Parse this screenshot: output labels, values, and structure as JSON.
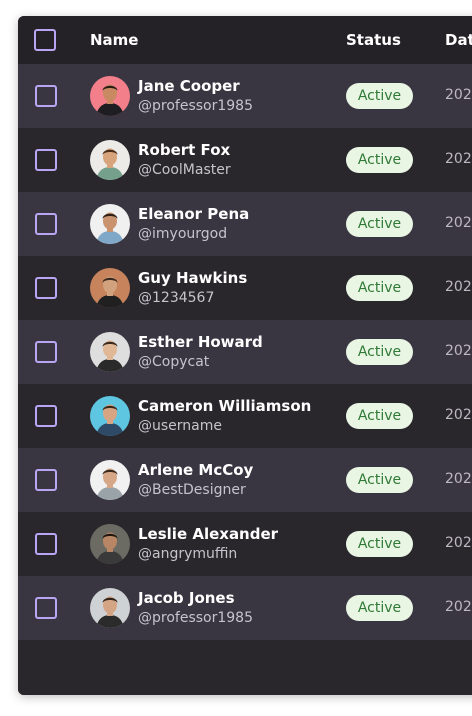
{
  "header": {
    "name_label": "Name",
    "status_label": "Status",
    "date_label": "Dat"
  },
  "colors": {
    "card_bg": "#2a282e",
    "row_alt": "#3a3641",
    "checkbox_border": "#b9a6f2",
    "badge_bg": "#e9f6e4",
    "badge_text": "#2f7a36"
  },
  "users": [
    {
      "name": "Jane Cooper",
      "handle": "@professor1985",
      "status": "Active",
      "date": "202",
      "avatar_bg": "#f27f8a",
      "skin": "#c98a63",
      "hair": "#2b1d16",
      "shirt": "#1d1d22"
    },
    {
      "name": "Robert Fox",
      "handle": "@CoolMaster",
      "status": "Active",
      "date": "202",
      "avatar_bg": "#ecebe8",
      "skin": "#d7a47c",
      "hair": "#4a2f1d",
      "shirt": "#74a08c"
    },
    {
      "name": "Eleanor Pena",
      "handle": "@imyourgod",
      "status": "Active",
      "date": "202",
      "avatar_bg": "#f0f0f0",
      "skin": "#c8936e",
      "hair": "#2c2019",
      "shirt": "#7fa8c8"
    },
    {
      "name": "Guy Hawkins",
      "handle": "@1234567",
      "status": "Active",
      "date": "202",
      "avatar_bg": "#c7835c",
      "skin": "#d2a17e",
      "hair": "#3a2a20",
      "shirt": "#202020"
    },
    {
      "name": "Esther Howard",
      "handle": "@Copycat",
      "status": "Active",
      "date": "202",
      "avatar_bg": "#dedede",
      "skin": "#e0b896",
      "hair": "#3b2a1f",
      "shirt": "#2a2a2a"
    },
    {
      "name": "Cameron Williamson",
      "handle": "@username",
      "status": "Active",
      "date": "202",
      "avatar_bg": "#5ec6e0",
      "skin": "#d8a584",
      "hair": "#3a2a1e",
      "shirt": "#2f4a66"
    },
    {
      "name": "Arlene McCoy",
      "handle": "@BestDesigner",
      "status": "Active",
      "date": "202",
      "avatar_bg": "#f1f1f1",
      "skin": "#d6a888",
      "hair": "#3a2a1e",
      "shirt": "#9aa4a8"
    },
    {
      "name": "Leslie Alexander",
      "handle": "@angrymuffin",
      "status": "Active",
      "date": "202",
      "avatar_bg": "#6b6b63",
      "skin": "#b98665",
      "hair": "#1e1611",
      "shirt": "#3a3a3a"
    },
    {
      "name": "Jacob Jones",
      "handle": "@professor1985",
      "status": "Active",
      "date": "202",
      "avatar_bg": "#cfd2d4",
      "skin": "#d4a585",
      "hair": "#2f241c",
      "shirt": "#2b2b2b"
    }
  ]
}
